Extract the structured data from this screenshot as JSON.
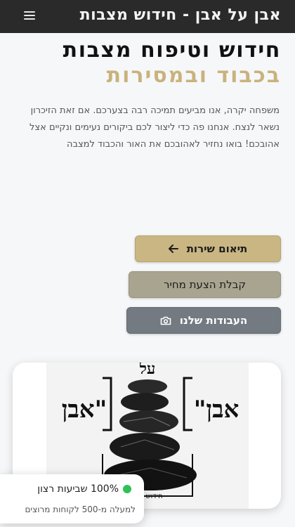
{
  "header": {
    "brand": "אבן על אבן - חידוש מצבות",
    "menu_icon": "hamburger-menu-icon"
  },
  "hero": {
    "title_line1": "חידוש וטיפוח מצבות",
    "title_line2": "בכבוד ובמסירות",
    "intro": "משפחה יקרה, אנו מביעים תמיכה רבה בצערכם. אם זאת הזיכרון נשאר לנצח. אנחנו פה כדי ליצור לכם ביקורים נעימים ונקיים אצל אהובכם! בואו נחזיר לאהובכם את האור והכבוד למצבה"
  },
  "actions": {
    "schedule": {
      "label": "תיאום שירות",
      "icon": "arrow-left-icon"
    },
    "quote": {
      "label": "קבלת הצעת מחיר"
    },
    "works": {
      "label": "העבודות שלנו",
      "icon": "camera-icon"
    }
  },
  "logo": {
    "top": "על",
    "left": "אבן\"",
    "right": "\"אבן",
    "bottom": "• חידוש מ"
  },
  "trust": {
    "headline": "100% שביעות רצון",
    "subline": "למעלה מ-500 לקוחות מרוצים"
  },
  "colors": {
    "gold": "#c9b27c",
    "dark": "#2a2a2a",
    "status_green": "#2ec158"
  }
}
